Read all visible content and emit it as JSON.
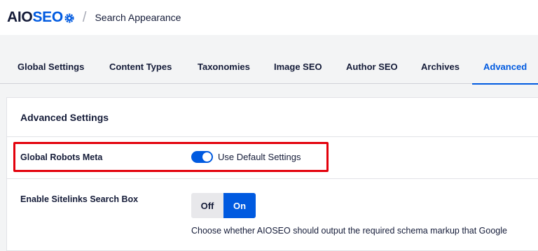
{
  "header": {
    "logo_main": "AIO",
    "logo_accent": "SEO",
    "separator": "/",
    "page_title": "Search Appearance"
  },
  "tabs": [
    {
      "label": "Global Settings",
      "active": false
    },
    {
      "label": "Content Types",
      "active": false
    },
    {
      "label": "Taxonomies",
      "active": false
    },
    {
      "label": "Image SEO",
      "active": false
    },
    {
      "label": "Author SEO",
      "active": false
    },
    {
      "label": "Archives",
      "active": false
    },
    {
      "label": "Advanced",
      "active": true
    }
  ],
  "card": {
    "title": "Advanced Settings",
    "global_robots": {
      "label": "Global Robots Meta",
      "toggle_label": "Use Default Settings",
      "toggle_on": true
    },
    "sitelinks": {
      "label": "Enable Sitelinks Search Box",
      "off_label": "Off",
      "on_label": "On",
      "selected": "On",
      "description": "Choose whether AIOSEO should output the required schema markup that Google"
    }
  },
  "colors": {
    "accent": "#005ae0",
    "highlight": "#e3000b",
    "text": "#141b38"
  },
  "icons": {
    "logo_gear": "gear-icon"
  }
}
